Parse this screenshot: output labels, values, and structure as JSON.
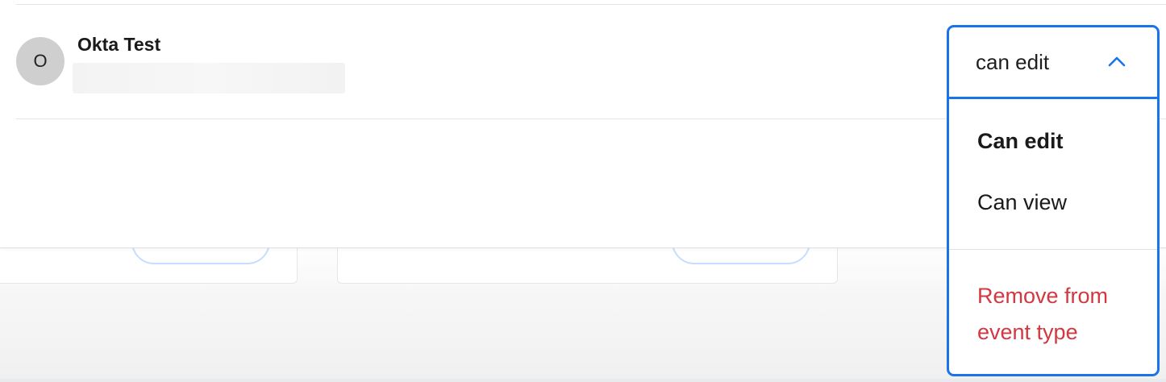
{
  "user": {
    "initial": "O",
    "name": "Okta Test"
  },
  "permission": {
    "current_value": "can edit",
    "options": [
      {
        "label": "Can edit",
        "selected": true
      },
      {
        "label": "Can view",
        "selected": false
      }
    ],
    "remove_label": "Remove from event type"
  },
  "colors": {
    "accent": "#1a73e8",
    "danger": "#d2383f",
    "avatar_bg": "#cfcfcf"
  },
  "icons": {
    "dropdown_toggle": "chevron-up-icon"
  }
}
